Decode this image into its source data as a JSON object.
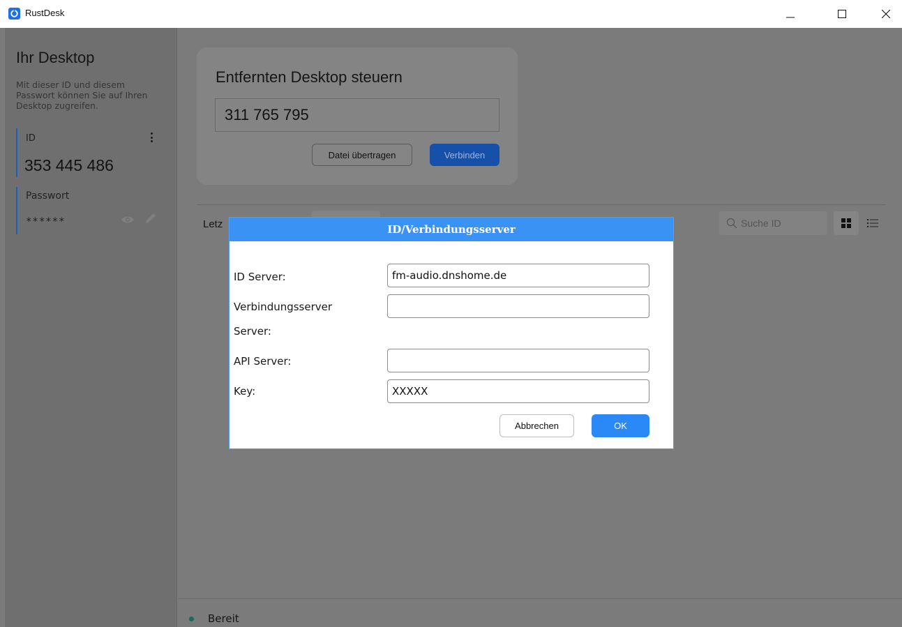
{
  "window": {
    "title": "RustDesk",
    "controls": [
      "minimize",
      "maximize",
      "close"
    ]
  },
  "sidebar": {
    "title": "Ihr Desktop",
    "description": "Mit dieser ID und diesem Passwort können Sie auf Ihren Desktop zugreifen.",
    "id_label": "ID",
    "id_value": "353 445 486",
    "password_label": "Passwort",
    "password_value": "******"
  },
  "connect": {
    "title": "Entfernten Desktop steuern",
    "remote_id": "311 765 795",
    "transfer_button": "Datei übertragen",
    "connect_button": "Verbinden"
  },
  "peers": {
    "recent_label_visible": "Letz",
    "search_placeholder": "Suche ID"
  },
  "status": {
    "text": "Bereit",
    "color": "#1a6a5b"
  },
  "dialog": {
    "title": "ID/Verbindungsserver",
    "id_server_label": "ID Server:",
    "id_server_value": "fm-audio.dnshome.de",
    "relay_label_line1": "Verbindungsserver",
    "relay_label_line2": "Server:",
    "relay_value": "",
    "api_label": "API Server:",
    "api_value": "",
    "key_label": "Key:",
    "key_value": "XXXXX",
    "cancel_button": "Abbrechen",
    "ok_button": "OK"
  },
  "colors": {
    "accent": "#2a88f7",
    "dialog_header": "#3a92f5",
    "overlay": "#7b7b7b"
  }
}
